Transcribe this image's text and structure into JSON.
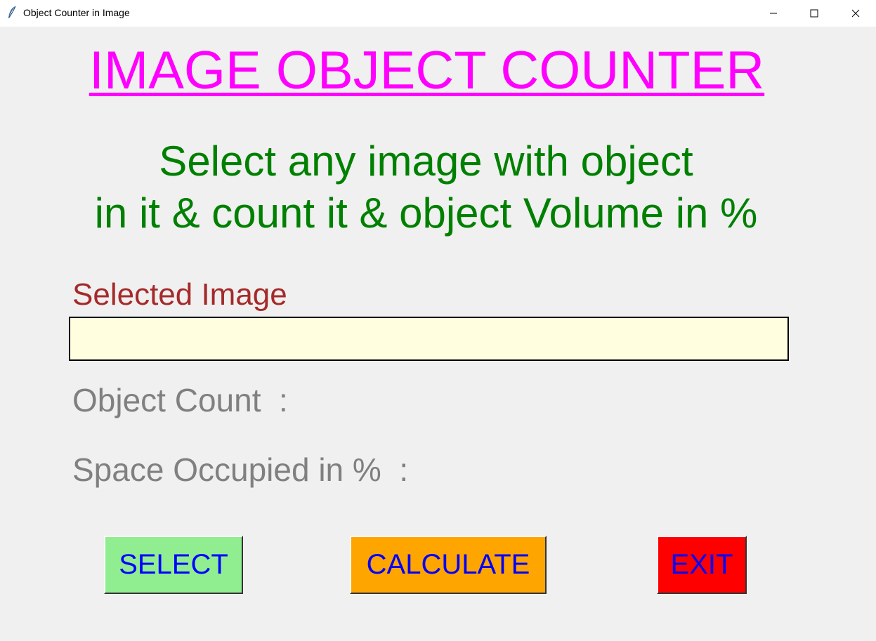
{
  "window": {
    "title": "Object Counter in Image",
    "icon": "feather-icon",
    "controls": [
      "minimize-icon",
      "maximize-icon",
      "close-icon"
    ]
  },
  "heading": "IMAGE OBJECT COUNTER",
  "subtitle": {
    "line1": "Select any image with object",
    "line2": "in it & count it & object Volume in %"
  },
  "selected_image": {
    "label": "Selected Image",
    "value": ""
  },
  "object_count": {
    "label": "Object Count  :"
  },
  "space_occupied": {
    "label": "Space Occupied in %  :"
  },
  "buttons": {
    "select": "SELECT",
    "calculate": "CALCULATE",
    "exit": "EXIT"
  },
  "colors": {
    "heading": "#ff00ff",
    "subtitle": "#008000",
    "selected_label": "#a52a2a",
    "info_label": "#808080",
    "input_bg": "#ffffe0",
    "button_text": "#0000ff",
    "select_bg": "#90ee90",
    "calculate_bg": "#ffa500",
    "exit_bg": "#ff0000"
  }
}
